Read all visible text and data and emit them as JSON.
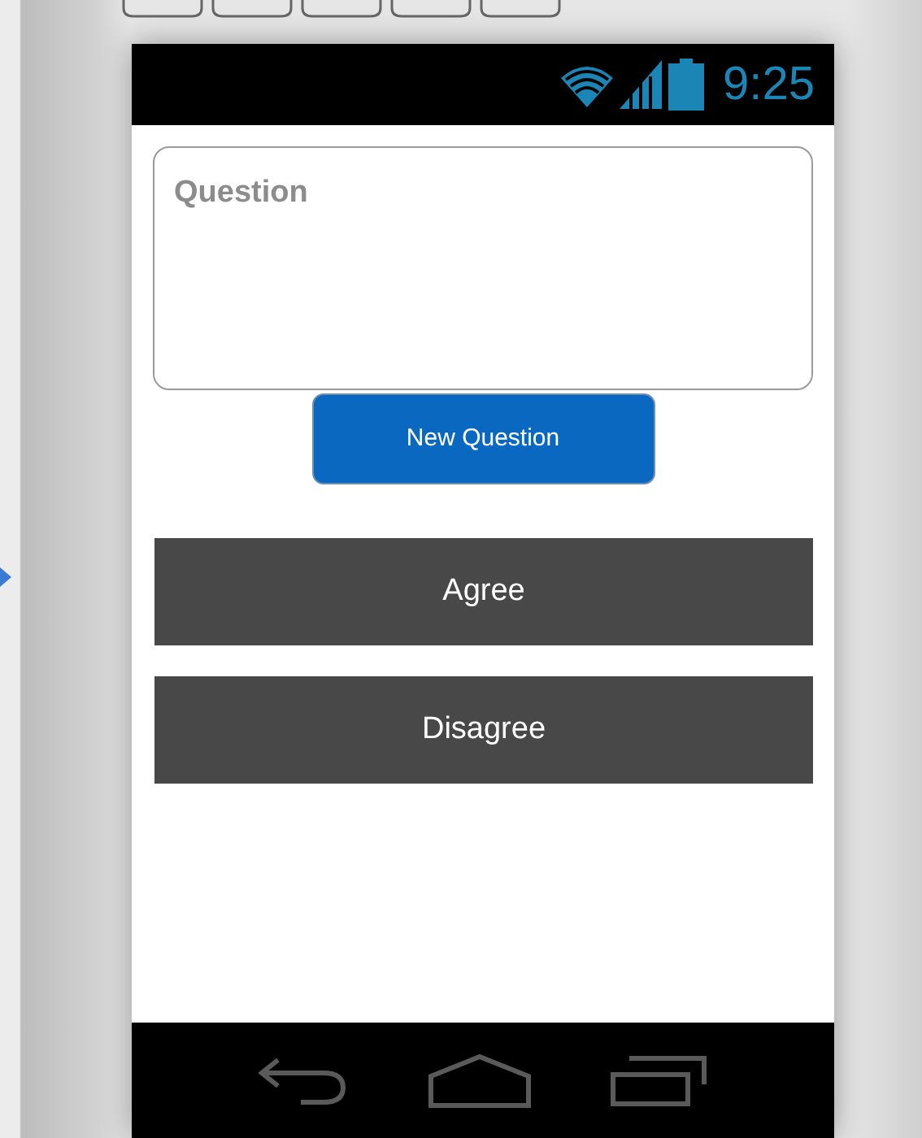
{
  "status_bar": {
    "time": "9:25"
  },
  "question_field": {
    "placeholder": "Question"
  },
  "new_question_button": {
    "label": "New Question"
  },
  "answer_buttons": [
    {
      "label": "Agree"
    },
    {
      "label": "Disagree"
    }
  ]
}
